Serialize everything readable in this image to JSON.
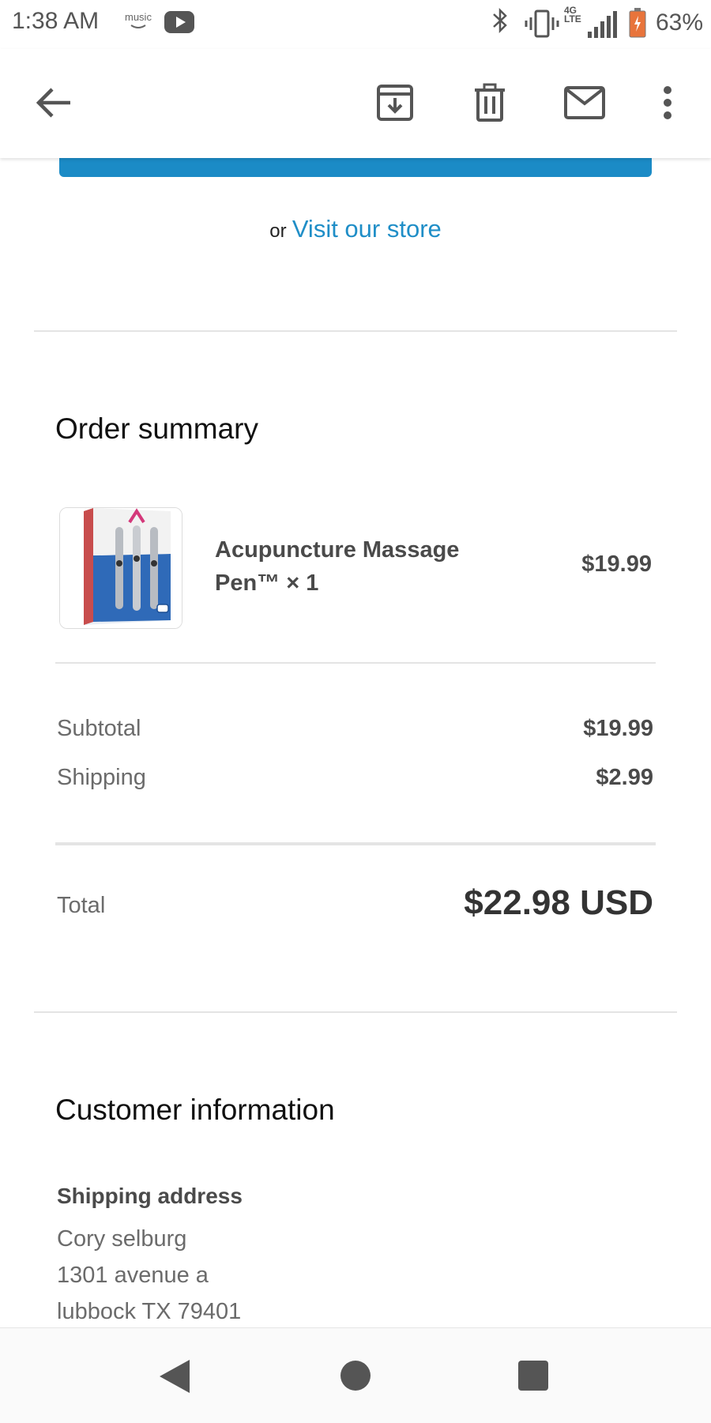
{
  "status_bar": {
    "time": "1:38 AM",
    "music_label": "music",
    "network_type": "4G",
    "network_sub": "LTE",
    "battery_percent": "63%",
    "icons": [
      "amazon-music-icon",
      "youtube-icon",
      "bluetooth-icon",
      "vibrate-icon",
      "signal-icon",
      "battery-icon"
    ]
  },
  "app_bar": {
    "icons": [
      "back-arrow-icon",
      "archive-icon",
      "delete-icon",
      "mark-unread-icon",
      "more-options-icon"
    ]
  },
  "email": {
    "store_prefix": "or",
    "store_link": "Visit our store",
    "order_summary_title": "Order summary",
    "product": {
      "name": "Acupuncture Massage Pen™ × 1",
      "price": "$19.99",
      "image_text": "Acupuncture Massage Pen™"
    },
    "subtotal_label": "Subtotal",
    "subtotal_value": "$19.99",
    "shipping_label": "Shipping",
    "shipping_value": "$2.99",
    "total_label": "Total",
    "total_value": "$22.98 USD",
    "customer_info_title": "Customer information",
    "shipping_address_label": "Shipping address",
    "address": {
      "name": "Cory selburg",
      "line1": "1301 avenue a",
      "line2": "lubbock TX 79401"
    }
  },
  "colors": {
    "link": "#1f8ec7",
    "cta": "#1b8bc6",
    "battery": "#e8743b"
  }
}
